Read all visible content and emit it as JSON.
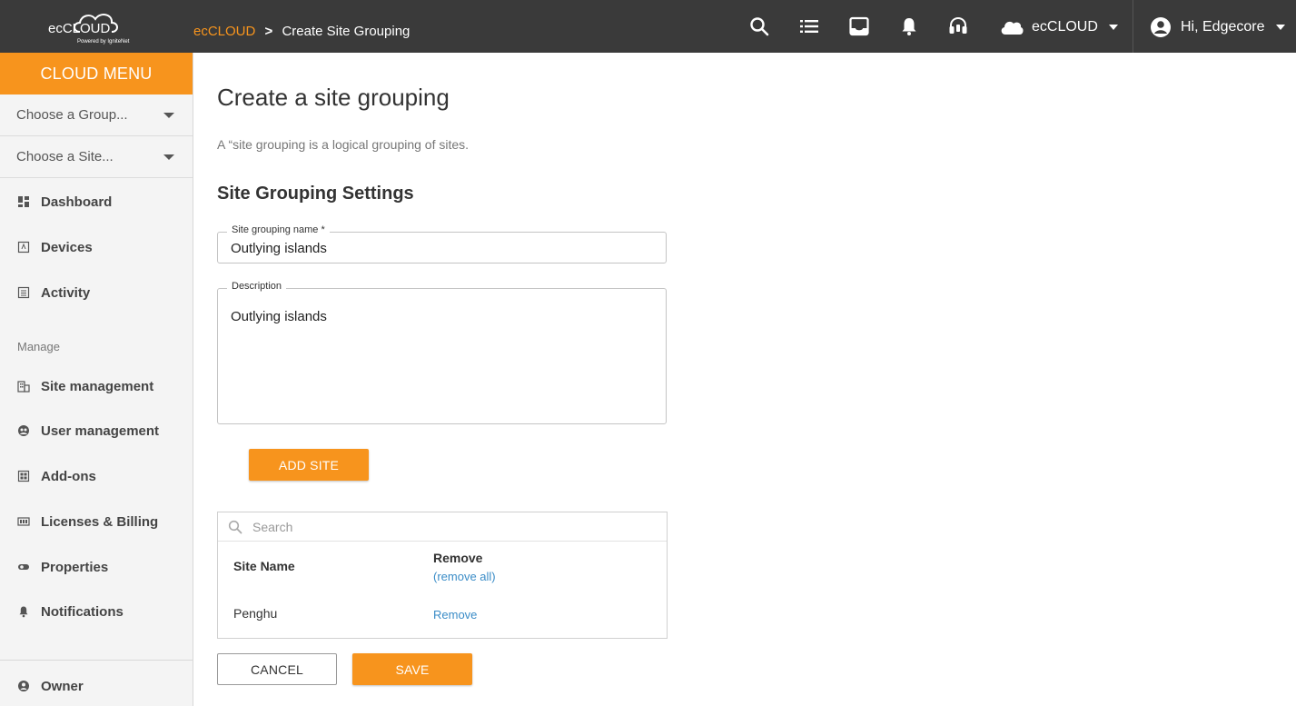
{
  "header": {
    "logo_text": "ecCLOUD",
    "logo_tagline": "Powered by IgniteNet",
    "breadcrumb": {
      "root": "ecCLOUD",
      "separator": ">",
      "current": "Create Site Grouping"
    },
    "icons": [
      "search-icon",
      "list-icon",
      "inbox-icon",
      "bell-icon",
      "support-icon"
    ],
    "cloud_selector": {
      "icon": "cloud-icon",
      "label": "ecCLOUD"
    },
    "user_menu": {
      "icon": "account-icon",
      "label": "Hi, Edgecore"
    }
  },
  "sidebar": {
    "menu_title": "CLOUD MENU",
    "group_select": "Choose a Group...",
    "site_select": "Choose a Site...",
    "items": [
      {
        "label": "Dashboard",
        "icon": "dashboard-icon"
      },
      {
        "label": "Devices",
        "icon": "devices-icon"
      },
      {
        "label": "Activity",
        "icon": "activity-icon"
      }
    ],
    "manage_label": "Manage",
    "manage_items": [
      {
        "label": "Site management",
        "icon": "building-icon"
      },
      {
        "label": "User management",
        "icon": "user-management-icon"
      },
      {
        "label": "Add-ons",
        "icon": "addons-icon"
      },
      {
        "label": "Licenses & Billing",
        "icon": "license-icon"
      },
      {
        "label": "Properties",
        "icon": "properties-icon"
      },
      {
        "label": "Notifications",
        "icon": "bell-icon"
      }
    ],
    "owner": {
      "label": "Owner",
      "icon": "owner-icon"
    }
  },
  "main": {
    "title": "Create a site grouping",
    "description": "A “site grouping is a logical grouping of sites.",
    "settings_title": "Site Grouping Settings",
    "name_field": {
      "label": "Site grouping name *",
      "value": "Outlying islands"
    },
    "description_field": {
      "label": "Description",
      "value": "Outlying islands"
    },
    "add_site_label": "ADD SITE",
    "search_placeholder": "Search",
    "table": {
      "col_site_name": "Site Name",
      "col_remove": "Remove",
      "remove_all_label": "(remove all)",
      "rows": [
        {
          "site_name": "Penghu",
          "remove_label": "Remove"
        }
      ]
    },
    "cancel_label": "CANCEL",
    "save_label": "SAVE"
  },
  "colors": {
    "accent": "#f7941d",
    "topbar": "#3a3a3a",
    "link": "#3a8cc7"
  }
}
